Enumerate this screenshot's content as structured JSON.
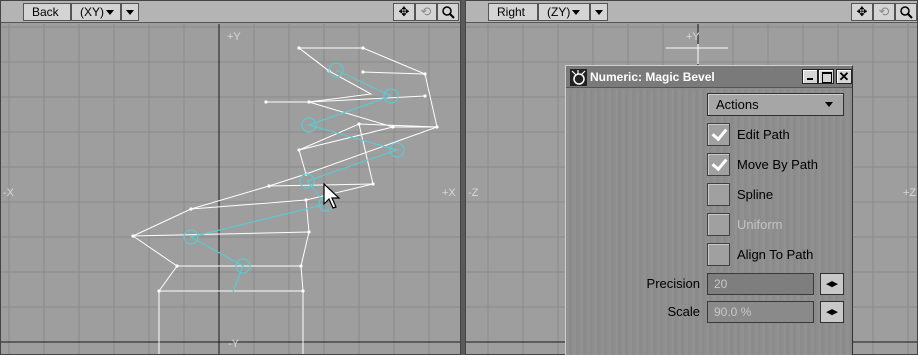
{
  "viewports": {
    "back": {
      "name": "Back",
      "mode": "(XY)",
      "axis_top": "+Y",
      "axis_bottom": "-Y",
      "axis_left": "-X",
      "axis_right": "+X"
    },
    "right": {
      "name": "Right",
      "mode": "(ZY)",
      "axis_top": "+Y",
      "axis_left": "-Z",
      "axis_right": "+Z"
    }
  },
  "tools": {
    "move": "✥",
    "rotate": "⟲",
    "zoom": "🔍"
  },
  "dialog": {
    "title": "Numeric: Magic Bevel",
    "actions_label": "Actions",
    "checkboxes": [
      {
        "label": "Edit Path",
        "checked": true,
        "enabled": true
      },
      {
        "label": "Move By Path",
        "checked": true,
        "enabled": true
      },
      {
        "label": "Spline",
        "checked": false,
        "enabled": true
      },
      {
        "label": "Uniform",
        "checked": false,
        "enabled": false
      },
      {
        "label": "Align To Path",
        "checked": false,
        "enabled": true
      }
    ],
    "precision_label": "Precision",
    "precision_value": "20",
    "scale_label": "Scale",
    "scale_value": "90.0 %",
    "close_glyph": "✕"
  },
  "colors": {
    "mesh": "#ffffff",
    "path": "#5fc8d0",
    "grid": "#8a8a8a",
    "axis": "#1a1a1a"
  }
}
